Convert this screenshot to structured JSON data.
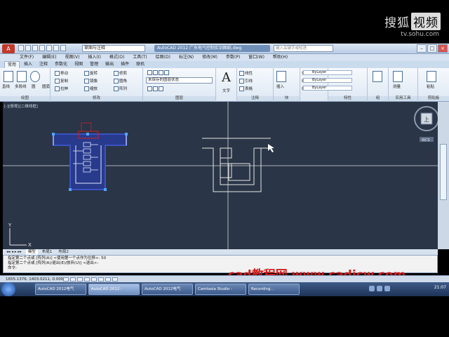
{
  "watermark": {
    "brand": "搜狐",
    "brand_badge": "视频",
    "site": "tv.sohu.com",
    "overlay": "cad教程网 www.cadjcw.com"
  },
  "titlebar": {
    "workspace": "草图与注释",
    "title": "AutoCAD 2012   广东电气控制实训图纸.dwg",
    "search_placeholder": "键入关键字或短语"
  },
  "menus": [
    "文件(F)",
    "编辑(E)",
    "视图(V)",
    "插入(I)",
    "格式(O)",
    "工具(T)",
    "绘图(D)",
    "标注(N)",
    "修改(M)",
    "参数(P)",
    "窗口(W)",
    "帮助(H)"
  ],
  "tabs": [
    "常用",
    "插入",
    "注释",
    "参数化",
    "视图",
    "管理",
    "输出",
    "插件",
    "联机"
  ],
  "ribbon": {
    "draw": [
      "直线",
      "多段线",
      "圆",
      "圆弧"
    ],
    "draw_label": "绘图",
    "modify": [
      "移动",
      "旋转",
      "修剪",
      "复制",
      "镜像",
      "圆角",
      "拉伸",
      "缩放",
      "阵列"
    ],
    "modify_label": "修改",
    "layer_value": "未保存的图层状态",
    "layer_label": "图层",
    "text_label": "文字",
    "annotation": [
      "线性",
      "引线",
      "表格"
    ],
    "annotation_label": "注释",
    "block": [
      "插入",
      "创建",
      "编辑",
      "编辑属性"
    ],
    "block_label": "块",
    "props": [
      "ByLayer",
      "ByLayer",
      "ByLayer"
    ],
    "props_label": "特性",
    "groups_label": "组",
    "util_label": "实用工具",
    "clip_label": "剪贴板",
    "util_items": [
      "测量",
      "粘贴"
    ]
  },
  "canvas": {
    "viewport_label": "[-][俯视][二维线框]",
    "viewcube_label": "上",
    "wcs": "WCS"
  },
  "layout_tabs": [
    "模型",
    "布局1",
    "布局2"
  ],
  "command": [
    "指定第二个点或 [阵列(A)] <使用第一个点作为位移>: 50",
    "指定第二个点或 [阵列(A)/退出(E)/放弃(U)] <退出>:",
    "命令:"
  ],
  "status": {
    "coords": "1655.1376, 1403.0211, 0.0000"
  },
  "taskbar": {
    "tasks": [
      "AutoCAD 2012电气",
      "AutoCAD 2012 -",
      "AutoCAD 2012电气",
      "Camtasia Studio -",
      "Recording..."
    ],
    "clock": "21:07"
  }
}
